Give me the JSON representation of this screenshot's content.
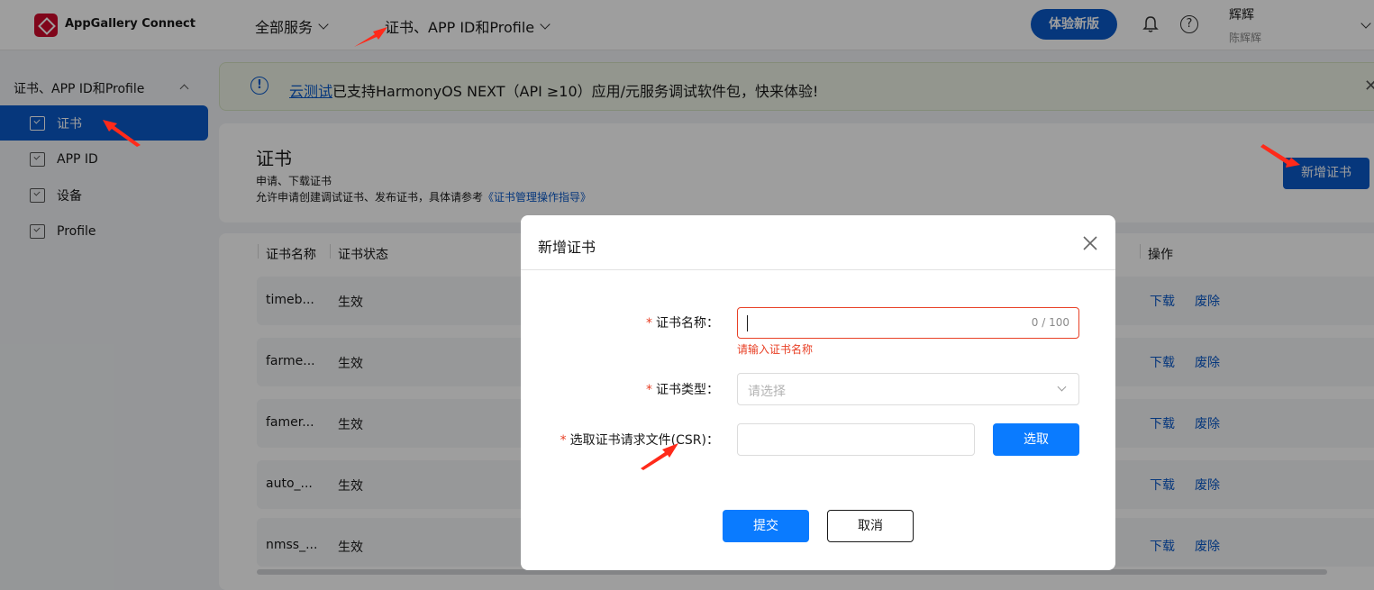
{
  "header": {
    "brand": "AppGallery Connect",
    "nav_all_services": "全部服务",
    "nav_current": "证书、APP ID和Profile",
    "try_new_button": "体验新版",
    "user_name": "辉辉",
    "user_sub": "陈辉辉",
    "help_glyph": "?",
    "icons": [
      "appgallery-logo-icon",
      "bell-icon",
      "help-icon",
      "chevron-down-icon"
    ]
  },
  "sidebar": {
    "group_label": "证书、APP ID和Profile",
    "items": [
      {
        "label": "证书",
        "active": true
      },
      {
        "label": "APP ID",
        "active": false
      },
      {
        "label": "设备",
        "active": false
      },
      {
        "label": "Profile",
        "active": false
      }
    ]
  },
  "notice": {
    "info_glyph": "!",
    "link_text": "云测试",
    "text": "已支持HarmonyOS NEXT（API ≥10）应用/元服务调试软件包，快来体验!",
    "close_glyph": "✕"
  },
  "page": {
    "title": "证书",
    "desc1": "申请、下载证书",
    "desc2_prefix": "允许申请创建调试证书、发布证书，具体请参考",
    "desc2_link": "《证书管理操作指导》",
    "add_button": "新增证书"
  },
  "table": {
    "columns": [
      "证书名称",
      "证书状态",
      "操作"
    ],
    "rows": [
      {
        "name": "timeb...",
        "status": "生效",
        "download": "下载",
        "revoke": "废除"
      },
      {
        "name": "farme...",
        "status": "生效",
        "download": "下载",
        "revoke": "废除"
      },
      {
        "name": "famer...",
        "status": "生效",
        "download": "下载",
        "revoke": "废除"
      },
      {
        "name": "auto_...",
        "status": "生效",
        "download": "下载",
        "revoke": "废除"
      },
      {
        "name": "nmss_...",
        "status": "生效",
        "download": "下载",
        "revoke": "废除"
      }
    ]
  },
  "modal": {
    "title": "新增证书",
    "required_mark": "*",
    "name_label": "证书名称：",
    "name_value": "",
    "name_counter": "0 / 100",
    "name_error": "请输入证书名称",
    "type_label": "证书类型：",
    "type_placeholder": "请选择",
    "csr_label": "选取证书请求文件(CSR)：",
    "csr_value": "",
    "choose_button": "选取",
    "submit_button": "提交",
    "cancel_button": "取消"
  },
  "colors": {
    "brand_blue": "#0a59c9",
    "primary_blue": "#0a7bff",
    "error_red": "#e84026",
    "logo_red": "#cf0a2c",
    "annotation_arrow": "#ff2a1a"
  }
}
